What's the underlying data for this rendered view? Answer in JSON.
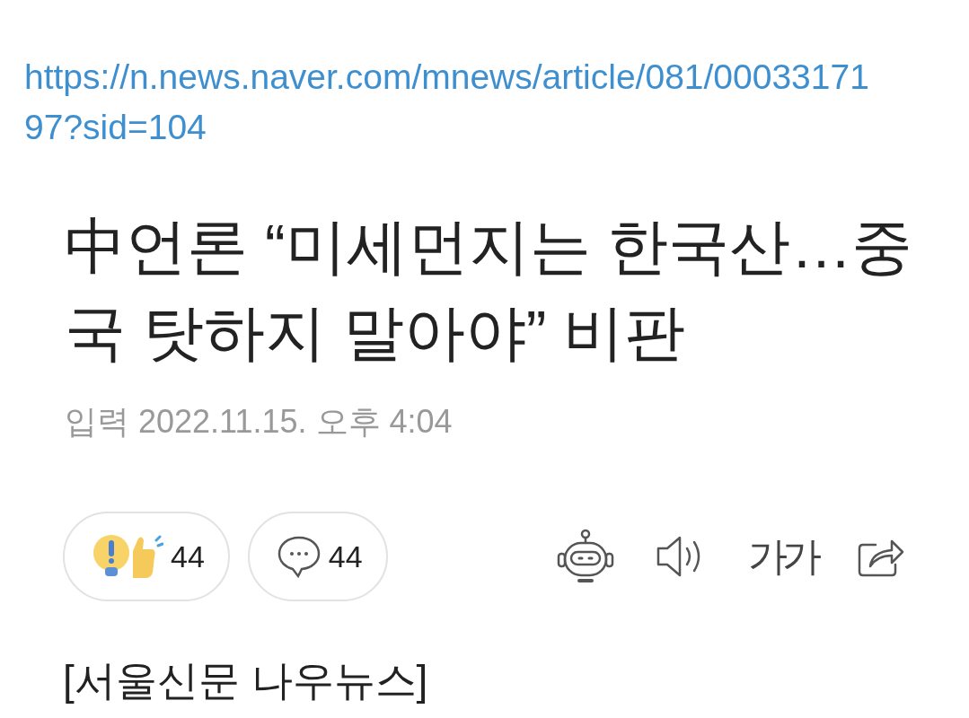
{
  "url_lines": [
    {
      "text": "https://n.news.naver.com/mnews/article/081/00033171"
    },
    {
      "text": "97?sid=104"
    }
  ],
  "headline_lines": [
    {
      "text": "中언론 “미세먼지는 한국산…중"
    },
    {
      "text": "국 탓하지 말아야” 비판"
    }
  ],
  "timestamp": {
    "text": "입력 2022.11.15. 오후 4:04"
  },
  "reactions": [
    {
      "kind": "reaction",
      "count": "44"
    },
    {
      "kind": "comment",
      "count": "44"
    }
  ],
  "tools": [
    {
      "kind": "summary"
    },
    {
      "kind": "audio"
    },
    {
      "kind": "font",
      "label": "가가"
    },
    {
      "kind": "share"
    }
  ],
  "source": {
    "text": "[서울신문 나우뉴스]"
  }
}
